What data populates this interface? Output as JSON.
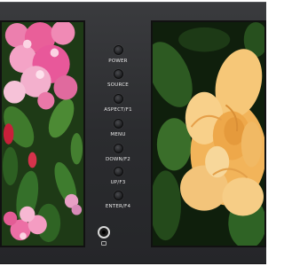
{
  "panel": {
    "buttons": [
      {
        "label": "POWER"
      },
      {
        "label": "SOURCE"
      },
      {
        "label": "ASPECT/F1"
      },
      {
        "label": "MENU"
      },
      {
        "label": "DOWN/F2"
      },
      {
        "label": "UP/F3"
      },
      {
        "label": "ENTER/F4"
      }
    ]
  },
  "screens": {
    "left": {
      "content": "pink-flowers-image"
    },
    "right": {
      "content": "yellow-rose-image"
    }
  },
  "colors": {
    "bezel": "#2e2f32",
    "label_text": "#e8e8e8",
    "pink_flower": "#e85a95",
    "rose": "#f4c06a",
    "foliage": "#2f5a25"
  }
}
